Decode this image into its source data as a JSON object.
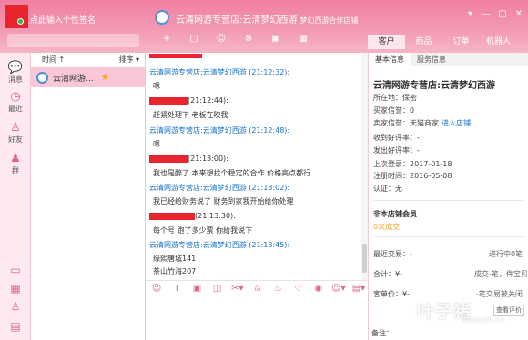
{
  "titlebar": {
    "signature": "点此输入个性签名",
    "shop_title": "云清网游专营店:云清梦幻西游",
    "shop_sub": "梦幻西游合作店铺",
    "tabs": [
      "客户",
      "商品",
      "订单",
      "机器人"
    ],
    "toolbar_icons": [
      "+",
      "▢",
      "☺",
      "⊗",
      "▣",
      "▦"
    ],
    "window_controls": [
      "▾",
      "—",
      "▢",
      "✕"
    ]
  },
  "rail": {
    "items": [
      {
        "icon": "message-icon",
        "label": "消息"
      },
      {
        "icon": "clock-icon",
        "label": "最近"
      },
      {
        "icon": "friend-icon",
        "label": "好友"
      },
      {
        "icon": "group-icon",
        "label": "群"
      }
    ]
  },
  "contacts": {
    "sort_time": "时间 ↑",
    "sort_label": "排序 ▾",
    "list": [
      {
        "name": "云清网游...",
        "starred": true
      }
    ]
  },
  "chat": {
    "messages": [
      {
        "sender": "云清网游专营店:云清梦幻西游",
        "time": "(21:12:32):",
        "role": "seller",
        "text": "嗯"
      },
      {
        "sender": "",
        "time": "(21:12:44):",
        "role": "buyer",
        "text": "赶紧处理下 老板在吹我"
      },
      {
        "sender": "云清网游专营店:云清梦幻西游",
        "time": "(21:12:48):",
        "role": "seller",
        "text": "嗯"
      },
      {
        "sender": "",
        "time": "(21:13:00):",
        "role": "buyer",
        "text": "我也是醉了 本来想找个稳定的合作 价格高点都行"
      },
      {
        "sender": "云清网游专营店:云清梦幻西游",
        "time": "(21:13:02):",
        "role": "seller",
        "text": "我已经给财务说了 财务到家我开始给你处理"
      },
      {
        "sender": "",
        "time": "(21:13:30):",
        "role": "buyer",
        "text": "每个号 跑了多少票 你给我说下"
      },
      {
        "sender": "云清网游专营店:云清梦幻西游",
        "time": "(21:13:45):",
        "role": "seller",
        "text": "缘熙唐城141"
      },
      {
        "sender": "",
        "time": "",
        "role": "seller",
        "text": "茶山竹海207"
      }
    ]
  },
  "chat_tools": [
    "☺",
    "T",
    "▣",
    "◫",
    "✂▾",
    "⍝",
    "♨",
    "♡",
    "◉",
    "☺▾",
    "▤▾"
  ],
  "rpanel": {
    "tabs": [
      "基本信息",
      "服务信息"
    ],
    "name": "云清网游专营店:云清梦幻西游",
    "lines": [
      {
        "label": "所在地：保密",
        "link": ""
      },
      {
        "label": "买家信誉：0",
        "link": ""
      },
      {
        "label": "卖家信誉：天猫商家",
        "link": "进入店铺"
      },
      {
        "label": "收到好评率：-",
        "link": ""
      },
      {
        "label": "发出好评率：-",
        "link": ""
      },
      {
        "label": "上次登录：2017-01-18",
        "link": ""
      },
      {
        "label": "注册时间：2016-05-08",
        "link": ""
      },
      {
        "label": "认证：无",
        "link": ""
      }
    ],
    "vip_title": "非本店铺会员",
    "vip_value": "0次成交",
    "recent_trade": "最近交易：-",
    "recent_trade_right": "进行中0笔",
    "total": "合计：¥-",
    "total_right": "成交-笔，件宝贝",
    "avg": "客单价：¥-",
    "avg_right": "-笔交易被关闭",
    "eval_btn": "查看评价",
    "note": "备注："
  },
  "watermark": {
    "text": "叶子猪",
    "url": "www.yzz.cn"
  }
}
